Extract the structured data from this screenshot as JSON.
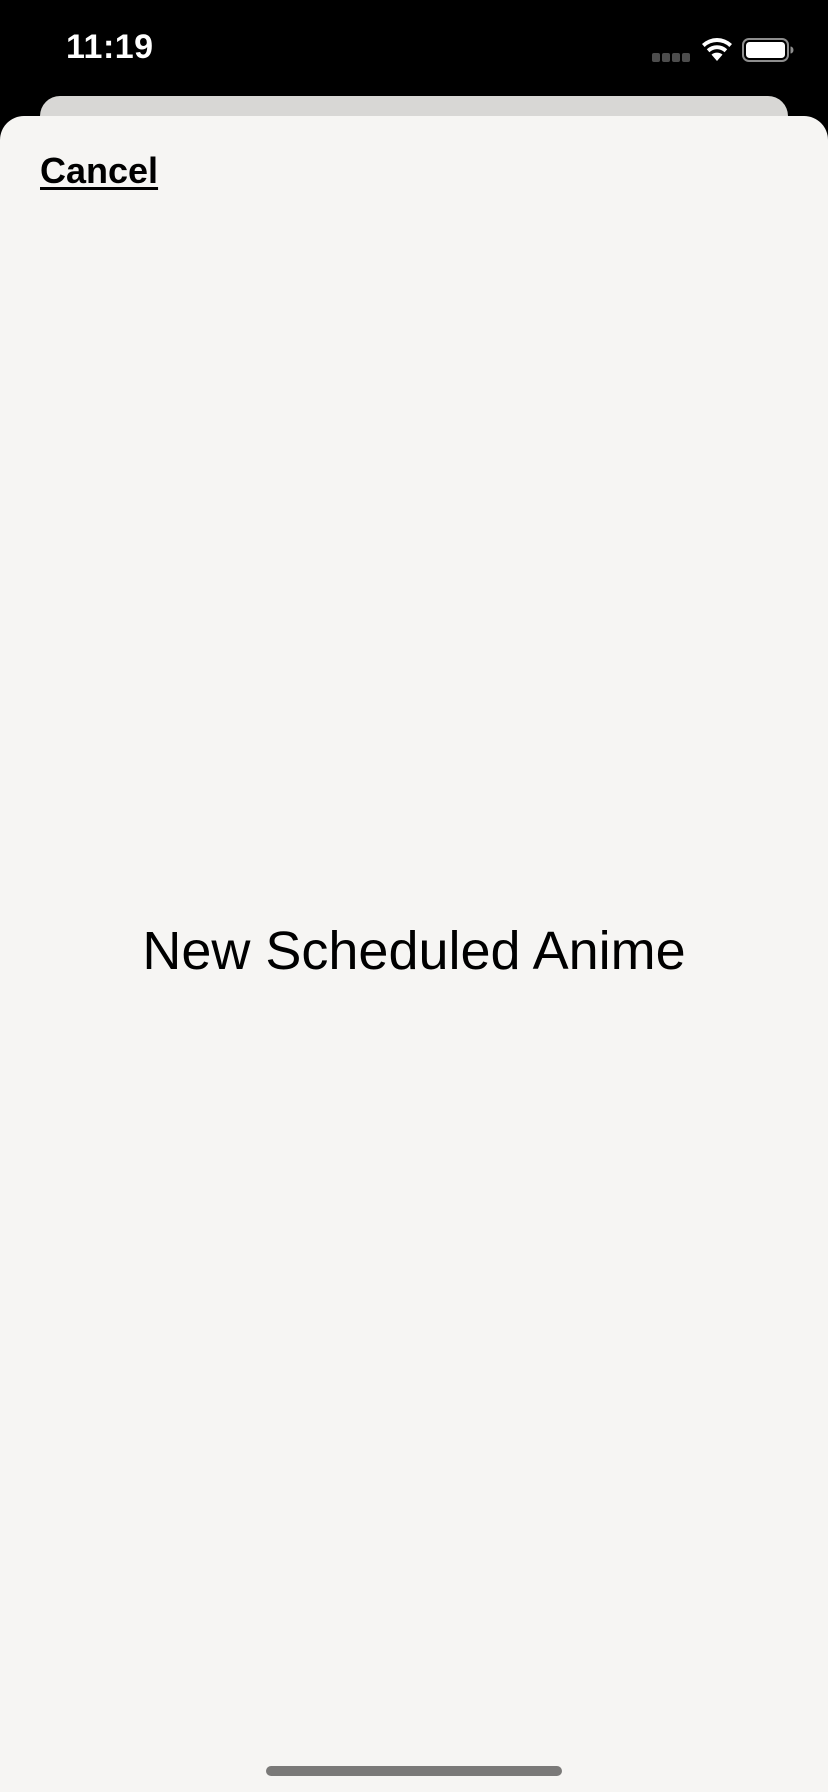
{
  "status_bar": {
    "time": "11:19",
    "icons": [
      "cellular-signal-icon",
      "wifi-icon",
      "battery-icon"
    ]
  },
  "sheet": {
    "cancel_label": "Cancel",
    "title": "New Scheduled Anime"
  },
  "colors": {
    "status_bar_bg": "#000000",
    "sheet_bg": "#f6f5f3",
    "stacked_card_bg": "#d8d7d5",
    "text": "#000000"
  }
}
